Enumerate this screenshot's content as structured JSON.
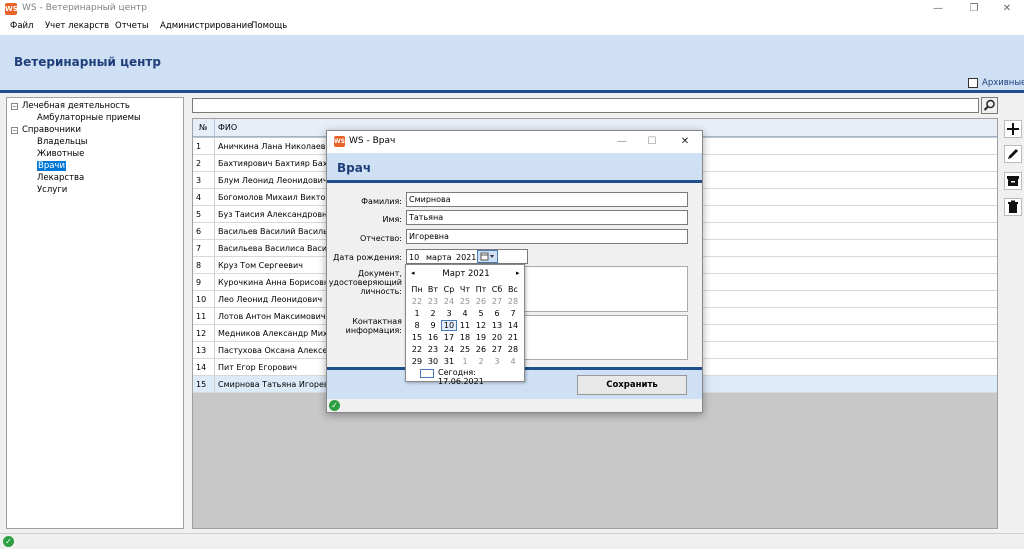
{
  "window": {
    "icon_text": "WS",
    "title": "WS - Ветеринарный центр",
    "minimize": "—",
    "maximize": "❐",
    "close": "✕"
  },
  "menu": [
    "Файл",
    "Учет лекарств",
    "Отчеты",
    "Администрирование",
    "Помощь"
  ],
  "header": {
    "title": "Ветеринарный центр",
    "archive_label": "Архивные"
  },
  "tree": {
    "groups": [
      {
        "label": "Лечебная деятельность",
        "expander": "−",
        "items": [
          {
            "label": "Амбулаторные приемы",
            "selected": false
          }
        ]
      },
      {
        "label": "Справочники",
        "expander": "−",
        "items": [
          {
            "label": "Владельцы",
            "selected": false
          },
          {
            "label": "Животные",
            "selected": false
          },
          {
            "label": "Врачи",
            "selected": true
          },
          {
            "label": "Лекарства",
            "selected": false
          },
          {
            "label": "Услуги",
            "selected": false
          }
        ]
      }
    ]
  },
  "search": {
    "value": "",
    "icon": "search-icon"
  },
  "grid": {
    "columns": [
      "№",
      "ФИО"
    ],
    "rows": [
      {
        "num": "1",
        "name": "Аничкина  Лана  Николаевн"
      },
      {
        "num": "2",
        "name": "Бахтиярович  Бахтияр  Бахт"
      },
      {
        "num": "3",
        "name": "Блум Леонид Леонидович"
      },
      {
        "num": "4",
        "name": "Богомолов Михаил Викторо"
      },
      {
        "num": "5",
        "name": "Буз  Таисия  Александровна"
      },
      {
        "num": "6",
        "name": "Васильев  Василий  Василье"
      },
      {
        "num": "7",
        "name": "Васильева Василиса Василь"
      },
      {
        "num": "8",
        "name": "Круз Том Сергеевич"
      },
      {
        "num": "9",
        "name": "Курочкина Анна Борисовна"
      },
      {
        "num": "10",
        "name": "Лео Леонид Леонидович"
      },
      {
        "num": "11",
        "name": "Лотов  Антон Максимович"
      },
      {
        "num": "12",
        "name": "Медников  Александр  Миха"
      },
      {
        "num": "13",
        "name": "Пастухова  Оксана Алексеев"
      },
      {
        "num": "14",
        "name": "Пит Егор Егорович"
      },
      {
        "num": "15",
        "name": "Смирнова  Татьяна  Игорев"
      }
    ],
    "selected_row": 14
  },
  "toolbar": [
    "add-icon",
    "edit-icon",
    "archive-icon",
    "delete-icon"
  ],
  "dialog": {
    "title": "WS - Врач",
    "icon_text": "WS",
    "heading": "Врач",
    "fields": {
      "last_name": {
        "label": "Фамилия:",
        "value": "Смирнова"
      },
      "first_name": {
        "label": "Имя:",
        "value": "Татьяна"
      },
      "patronymic": {
        "label": "Отчество:",
        "value": "Игоревна"
      },
      "birth_date": {
        "label": "Дата рождения:",
        "day": "10",
        "month": "марта",
        "year": "2021"
      },
      "document": {
        "label": "Документ, удостоверяющий личность:"
      },
      "contact": {
        "label": "Контактная информация:"
      }
    },
    "save_label": "Сохранить"
  },
  "calendar": {
    "title": "Март 2021",
    "prev": "◂",
    "next": "▸",
    "weekdays": [
      "Пн",
      "Вт",
      "Ср",
      "Чт",
      "Пт",
      "Сб",
      "Вс"
    ],
    "weeks": [
      [
        [
          "1",
          false
        ],
        [
          "2",
          false
        ],
        [
          "3",
          false
        ],
        [
          "4",
          false
        ],
        [
          "5",
          false
        ],
        [
          "6",
          false
        ],
        [
          "7",
          false
        ]
      ]
    ],
    "rows": [
      [
        "22",
        "23",
        "24",
        "25",
        "26",
        "27",
        "28"
      ],
      [
        "1",
        "2",
        "3",
        "4",
        "5",
        "6",
        "7"
      ],
      [
        "8",
        "9",
        "10",
        "11",
        "12",
        "13",
        "14"
      ],
      [
        "15",
        "16",
        "17",
        "18",
        "19",
        "20",
        "21"
      ],
      [
        "22",
        "23",
        "24",
        "25",
        "26",
        "27",
        "28"
      ],
      [
        "29",
        "30",
        "31",
        "1",
        "2",
        "3",
        "4"
      ]
    ],
    "other_month": [
      [
        0,
        0
      ],
      [
        0,
        1
      ],
      [
        0,
        2
      ],
      [
        0,
        3
      ],
      [
        0,
        4
      ],
      [
        0,
        5
      ],
      [
        0,
        6
      ],
      [
        5,
        3
      ],
      [
        5,
        4
      ],
      [
        5,
        5
      ],
      [
        5,
        6
      ]
    ],
    "selected": [
      2,
      2
    ],
    "today_label": "Сегодня: 17.06.2021"
  },
  "status": {
    "icon": "ok-icon",
    "glyph": "✓"
  }
}
